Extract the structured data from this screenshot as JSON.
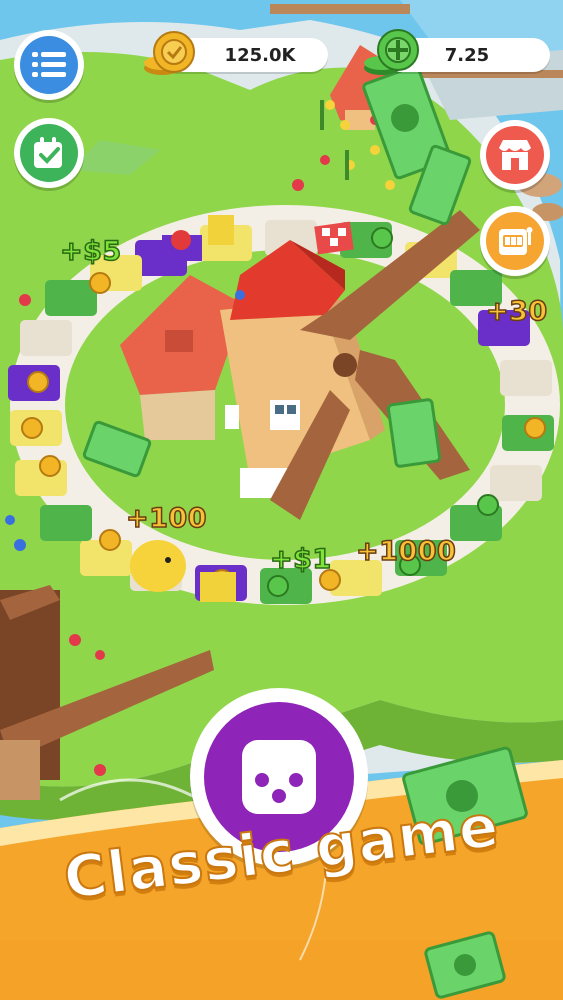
{
  "hud": {
    "coins_value": "125.0K",
    "cash_value": "7.25"
  },
  "icons": {
    "menu": "menu-list-icon",
    "calendar": "calendar-check-icon",
    "coin": "gold-coin-icon",
    "cash": "cash-stack-icon",
    "shop": "shop-icon",
    "slot": "slot-machine-icon",
    "dice": "dice-icon"
  },
  "board_rewards": [
    {
      "label": "+$5",
      "kind": "cash"
    },
    {
      "label": "+30",
      "kind": "coin"
    },
    {
      "label": "+100",
      "kind": "coin"
    },
    {
      "label": "+$1",
      "kind": "cash"
    },
    {
      "label": "+1000",
      "kind": "coin"
    }
  ],
  "banner": {
    "title": "Classic game"
  },
  "colors": {
    "water": "#6fc6ec",
    "grass": "#8fd64a",
    "banner_orange": "#f4a52a",
    "dice_purple": "#8f24b8",
    "shop_red": "#ef5a4e",
    "slot_orange": "#f6a531",
    "calendar_green": "#3db35a",
    "menu_blue": "#3a8de0"
  }
}
